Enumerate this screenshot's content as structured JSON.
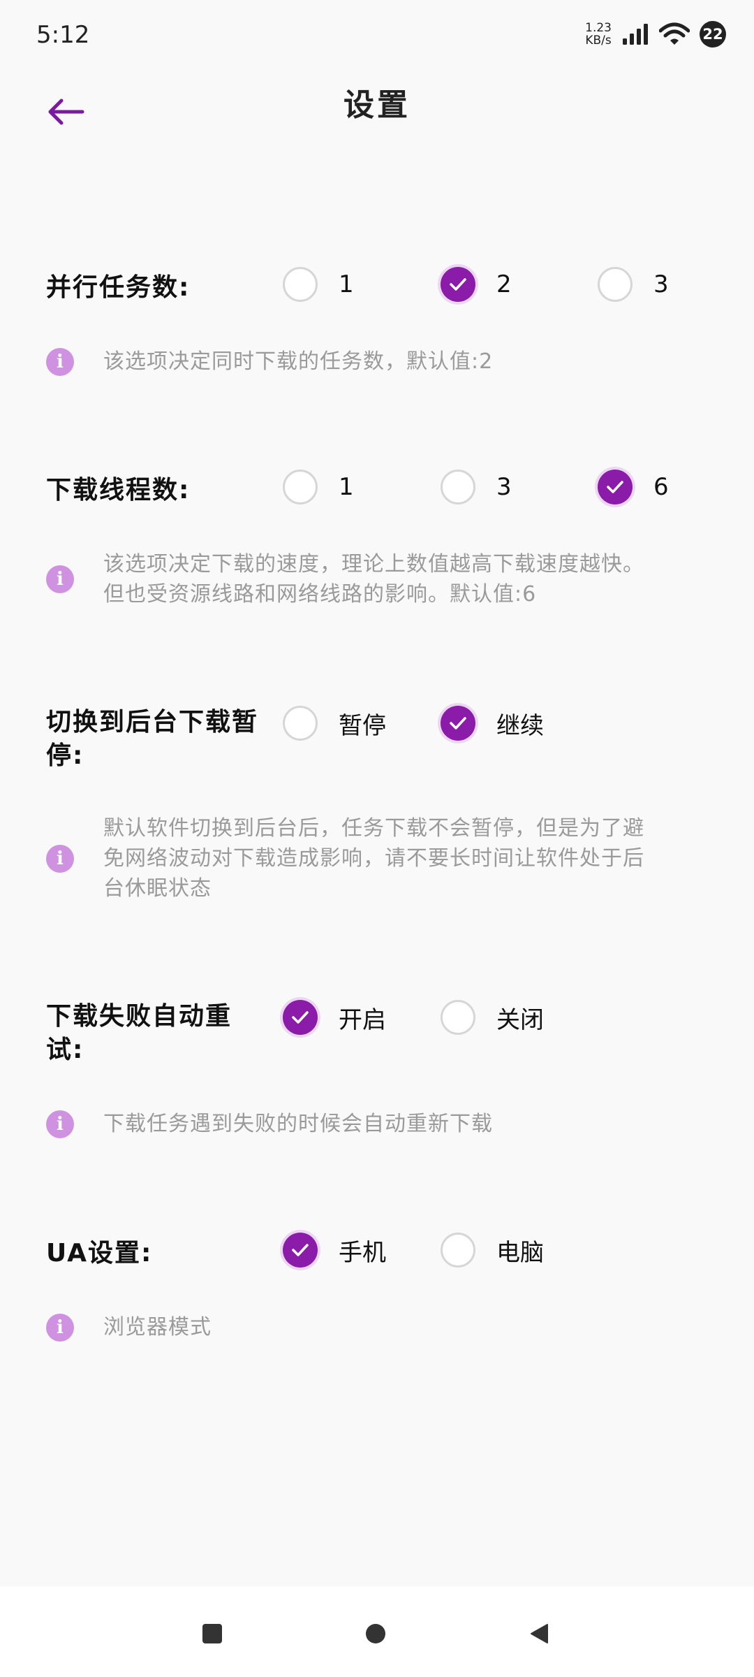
{
  "status_bar": {
    "time": "5:12",
    "net_speed_value": "1.23",
    "net_speed_unit": "KB/s",
    "notification_count": "22"
  },
  "header": {
    "title": "设置",
    "back_icon": "arrow-left-icon"
  },
  "settings": [
    {
      "label": "并行任务数:",
      "options": [
        {
          "label": "1",
          "selected": false
        },
        {
          "label": "2",
          "selected": true
        },
        {
          "label": "3",
          "selected": false
        }
      ],
      "info": "该选项决定同时下载的任务数，默认值:2"
    },
    {
      "label": "下载线程数:",
      "options": [
        {
          "label": "1",
          "selected": false
        },
        {
          "label": "3",
          "selected": false
        },
        {
          "label": "6",
          "selected": true
        }
      ],
      "info_lines": [
        "该选项决定下载的速度，理论上数值越高下载速度越快。",
        "但也受资源线路和网络线路的影响。默认值:6"
      ]
    },
    {
      "label_lines": [
        "切换到后台下载暂",
        "停:"
      ],
      "options": [
        {
          "label": "暂停",
          "selected": false
        },
        {
          "label": "继续",
          "selected": true
        }
      ],
      "info_lines": [
        "默认软件切换到后台后，任务下载不会暂停，但是为了避",
        "免网络波动对下载造成影响，请不要长时间让软件处于后",
        "台休眠状态"
      ]
    },
    {
      "label_lines": [
        "下载失败自动重",
        "试:"
      ],
      "options": [
        {
          "label": "开启",
          "selected": true
        },
        {
          "label": "关闭",
          "selected": false
        }
      ],
      "info": "下载任务遇到失败的时候会自动重新下载"
    },
    {
      "label": "UA设置:",
      "options": [
        {
          "label": "手机",
          "selected": true
        },
        {
          "label": "电脑",
          "selected": false
        }
      ],
      "info": "浏览器模式"
    }
  ],
  "nav": {
    "recents_icon": "square-icon",
    "home_icon": "circle-icon",
    "back_icon": "triangle-back-icon"
  },
  "colors": {
    "accent": "#8a1ca9",
    "info_icon": "#cf92e0",
    "info_text": "#9a9a9a",
    "background": "#f9f9f9"
  }
}
